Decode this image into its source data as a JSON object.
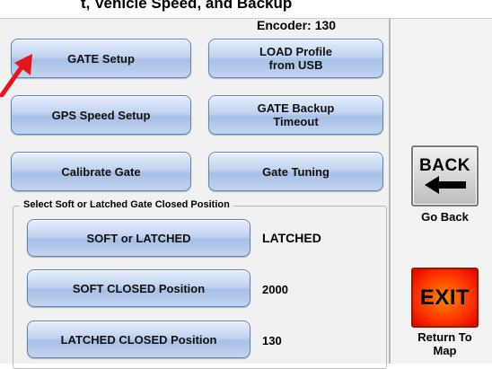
{
  "header": {
    "cut_off_text": "t, Vehicle Speed, and Backup"
  },
  "encoder": {
    "label": "Encoder:",
    "value": "130"
  },
  "buttons": {
    "gate_setup": "GATE Setup",
    "load_profile": "LOAD Profile\nfrom USB",
    "gps_speed_setup": "GPS Speed Setup",
    "gate_backup_timeout": "GATE Backup\nTimeout",
    "calibrate_gate": "Calibrate Gate",
    "gate_tuning": "Gate Tuning"
  },
  "gate_closed_group": {
    "legend": "Select Soft or Latched Gate Closed Position",
    "rows": [
      {
        "button": "SOFT or LATCHED",
        "value": "LATCHED"
      },
      {
        "button": "SOFT CLOSED Position",
        "value": "2000"
      },
      {
        "button": "LATCHED CLOSED Position",
        "value": "130"
      }
    ]
  },
  "side": {
    "back_label": "BACK",
    "back_caption": "Go Back",
    "exit_label": "EXIT",
    "exit_caption": "Return To\nMap"
  },
  "colors": {
    "arrow": "#e8141b",
    "button_border": "#5f83b8",
    "exit": "#ff3b00"
  },
  "icons": {
    "back": "left-arrow-icon",
    "annotation": "red-arrow-icon"
  }
}
